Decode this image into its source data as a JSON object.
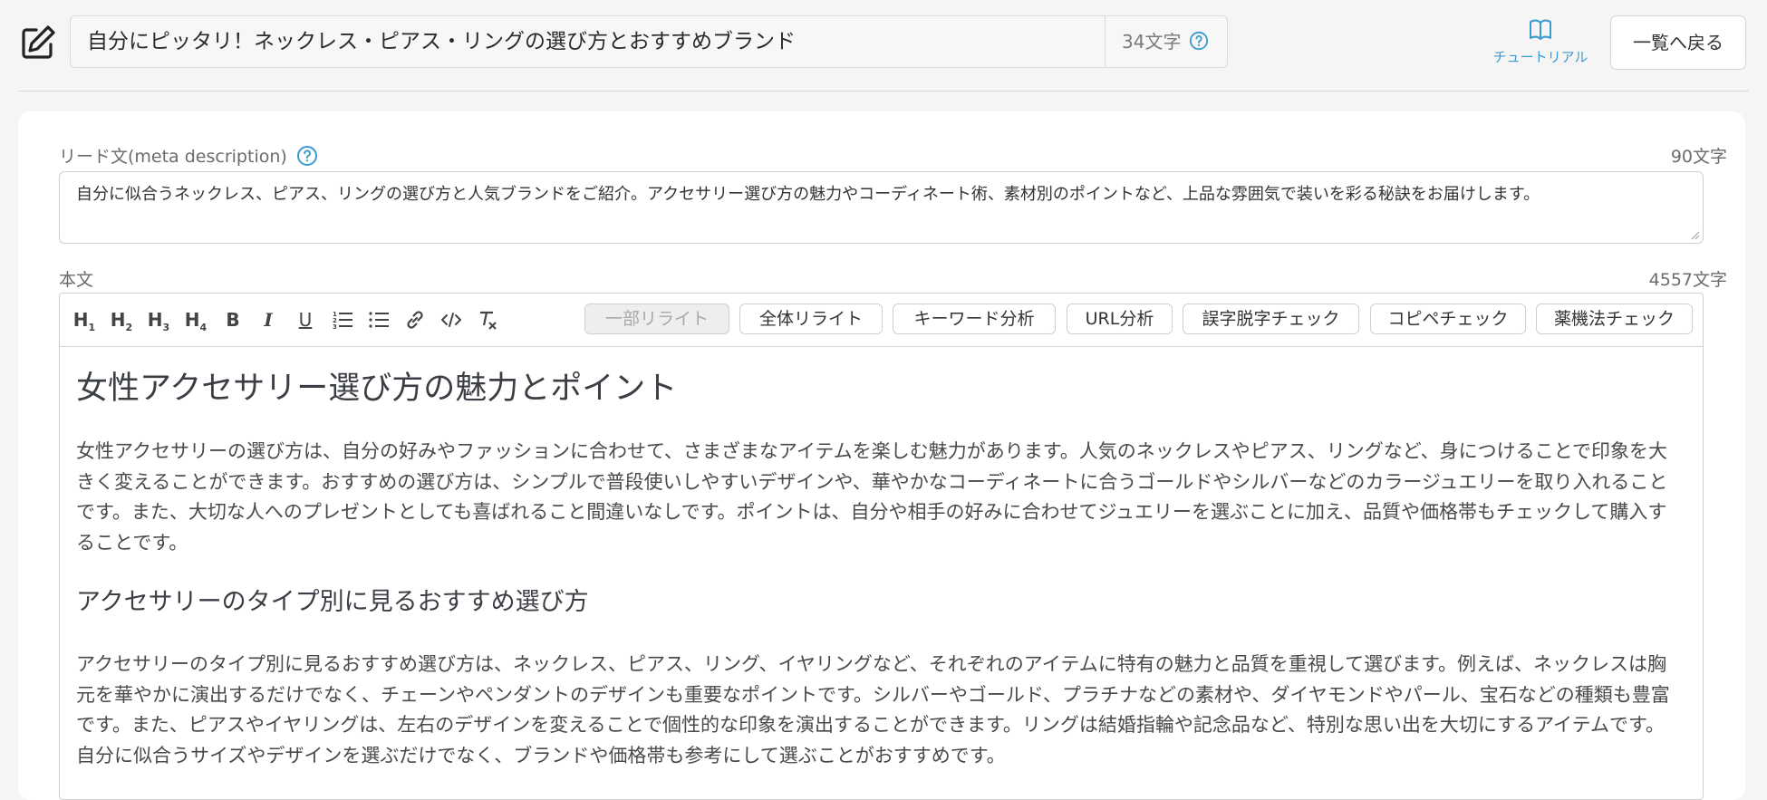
{
  "header": {
    "title": "自分にピッタリ！ネックレス・ピアス・リングの選び方とおすすめブランド",
    "title_count": "34文字",
    "tutorial_label": "チュートリアル",
    "back_label": "一覧へ戻る"
  },
  "lead": {
    "label": "リード文(meta description)",
    "count": "90文字",
    "text": "自分に似合うネックレス、ピアス、リングの選び方と人気ブランドをご紹介。アクセサリー選び方の魅力やコーディネート術、素材別のポイントなど、上品な雰囲気で装いを彩る秘訣をお届けします。"
  },
  "body": {
    "label": "本文",
    "count": "4557文字"
  },
  "toolbar": {
    "icons": [
      "H1",
      "H2",
      "H3",
      "H4",
      "B",
      "I",
      "U",
      "ordered-list-icon",
      "bullet-list-icon",
      "link-icon",
      "code-icon",
      "clear-format-icon"
    ],
    "buttons": [
      "一部リライト",
      "全体リライト",
      "キーワード分析",
      "URL分析",
      "誤字脱字チェック",
      "コピペチェック",
      "薬機法チェック"
    ]
  },
  "content": {
    "heading1": "女性アクセサリー選び方の魅力とポイント",
    "paragraph1": "女性アクセサリーの選び方は、自分の好みやファッションに合わせて、さまざまなアイテムを楽しむ魅力があります。人気のネックレスやピアス、リングなど、身につけることで印象を大きく変えることができます。おすすめの選び方は、シンプルで普段使いしやすいデザインや、華やかなコーディネートに合うゴールドやシルバーなどのカラージュエリーを取り入れることです。また、大切な人へのプレゼントとしても喜ばれること間違いなしです。ポイントは、自分や相手の好みに合わせてジュエリーを選ぶことに加え、品質や価格帯もチェックして購入することです。",
    "heading2": "アクセサリーのタイプ別に見るおすすめ選び方",
    "paragraph2": "アクセサリーのタイプ別に見るおすすめ選び方は、ネックレス、ピアス、リング、イヤリングなど、それぞれのアイテムに特有の魅力と品質を重視して選びます。例えば、ネックレスは胸元を華やかに演出するだけでなく、チェーンやペンダントのデザインも重要なポイントです。シルバーやゴールド、プラチナなどの素材や、ダイヤモンドやパール、宝石などの種類も豊富です。また、ピアスやイヤリングは、左右のデザインを変えることで個性的な印象を演出することができます。リングは結婚指輪や記念品など、特別な思い出を大切にするアイテムです。自分に似合うサイズやデザインを選ぶだけでなく、ブランドや価格帯も参考にして選ぶことがおすすめです。"
  },
  "colors": {
    "accent": "#3a9bd0",
    "background": "#f5f5f6",
    "disabled_button": "#eeeeee"
  }
}
